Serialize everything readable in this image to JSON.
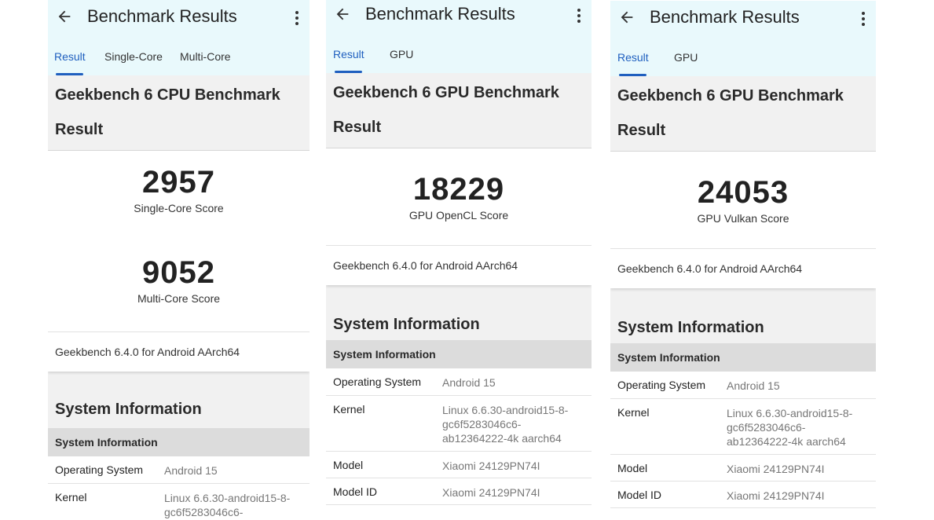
{
  "panels": [
    {
      "title": "Benchmark Results",
      "tabs": [
        "Result",
        "Single-Core",
        "Multi-Core"
      ],
      "heading": "Geekbench 6 CPU Benchmark",
      "result_label": "Result",
      "scores": [
        {
          "value": "2957",
          "label": "Single-Core Score"
        },
        {
          "value": "9052",
          "label": "Multi-Core Score"
        }
      ],
      "version": "Geekbench 6.4.0 for Android AArch64",
      "system_title": "System Information",
      "system_sub": "System Information",
      "rows": [
        {
          "k": "Operating System",
          "v": "Android 15"
        },
        {
          "k": "Kernel",
          "v": "Linux 6.6.30-android15-8-gc6f5283046c6-"
        }
      ]
    },
    {
      "title": "Benchmark Results",
      "tabs": [
        "Result",
        "GPU"
      ],
      "heading": "Geekbench 6 GPU Benchmark",
      "result_label": "Result",
      "scores": [
        {
          "value": "18229",
          "label": "GPU OpenCL Score"
        }
      ],
      "version": "Geekbench 6.4.0 for Android AArch64",
      "system_title": "System Information",
      "system_sub": "System Information",
      "rows": [
        {
          "k": "Operating System",
          "v": "Android 15"
        },
        {
          "k": "Kernel",
          "v": "Linux 6.6.30-android15-8-gc6f5283046c6-ab12364222-4k aarch64"
        },
        {
          "k": "Model",
          "v": "Xiaomi 24129PN74I"
        },
        {
          "k": "Model ID",
          "v": "Xiaomi 24129PN74I"
        }
      ]
    },
    {
      "title": "Benchmark Results",
      "tabs": [
        "Result",
        "GPU"
      ],
      "heading": "Geekbench 6 GPU Benchmark",
      "result_label": "Result",
      "scores": [
        {
          "value": "24053",
          "label": "GPU Vulkan Score"
        }
      ],
      "version": "Geekbench 6.4.0 for Android AArch64",
      "system_title": "System Information",
      "system_sub": "System Information",
      "rows": [
        {
          "k": "Operating System",
          "v": "Android 15"
        },
        {
          "k": "Kernel",
          "v": "Linux 6.6.30-android15-8-gc6f5283046c6-ab12364222-4k aarch64"
        },
        {
          "k": "Model",
          "v": "Xiaomi 24129PN74I"
        },
        {
          "k": "Model ID",
          "v": "Xiaomi 24129PN74I"
        }
      ]
    }
  ],
  "colors": {
    "appbar_bg": "#e9f9fc",
    "accent": "#1f5fbf",
    "section_bg": "#f1f1f1",
    "subheader_bg": "#dcdcdc"
  },
  "icons": [
    "arrow-back-icon",
    "more-vert-icon"
  ]
}
